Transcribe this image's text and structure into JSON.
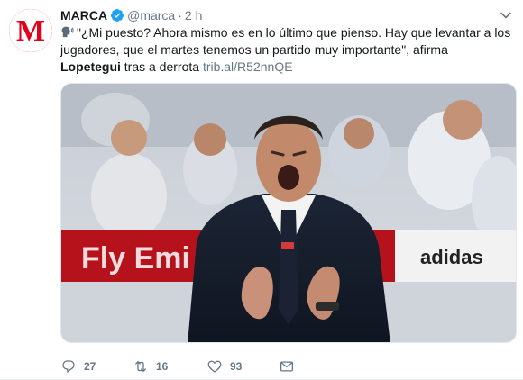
{
  "account": {
    "name": "MARCA",
    "handle": "@marca",
    "separator": "·",
    "time": "2 h",
    "avatar_letter": "M",
    "brand_color": "#e2001a",
    "verified_color": "#1da1f2"
  },
  "tweet": {
    "emoji": "speaking-head-icon",
    "text_before_bold": "\"¿Mi puesto? Ahora mismo es en lo último que pienso. Hay que levantar a los jugadores, que el martes tenemos un partido muy importante\", afirma ",
    "bold_name": "Lopetegui",
    "text_after_bold": " tras a derrota ",
    "link": "trib.al/R52nnQE"
  },
  "media": {
    "banner_text": "Fly Emi",
    "sponsor_right": "adidas"
  },
  "actions": {
    "reply_count": "27",
    "retweet_count": "16",
    "like_count": "93"
  }
}
